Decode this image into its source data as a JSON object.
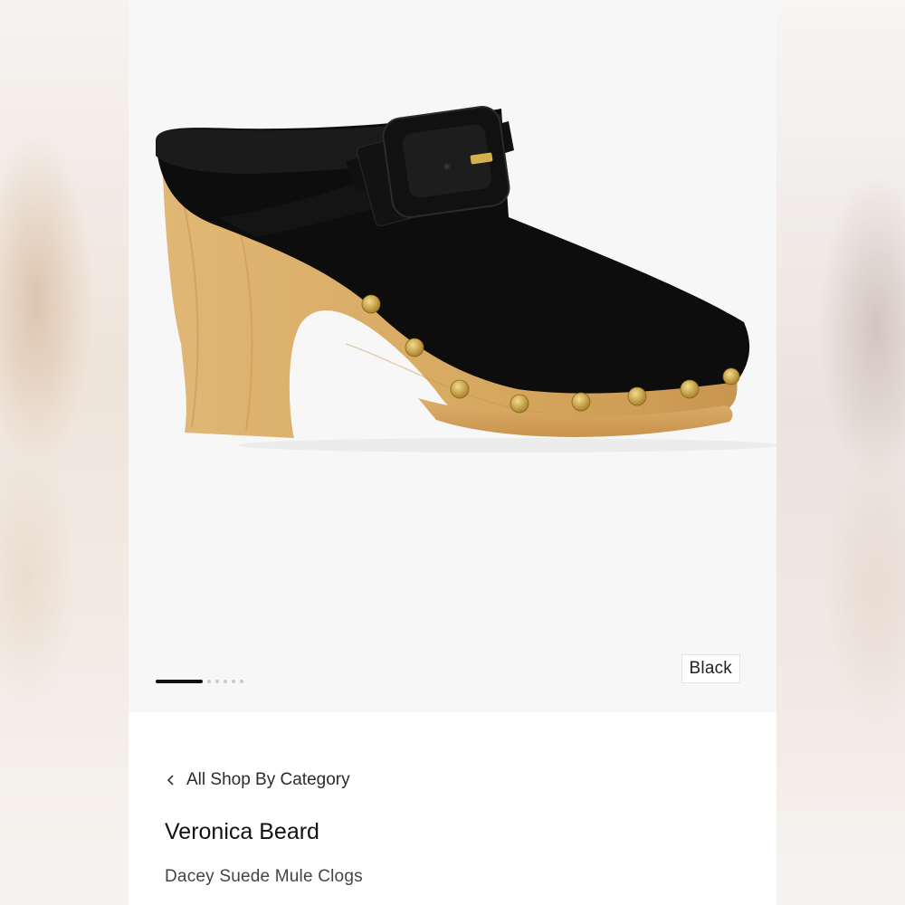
{
  "product": {
    "brand": "Veronica Beard",
    "name": "Dacey Suede Mule Clogs",
    "image_alt": "Black suede mule clog with wooden heel and gold studs",
    "selected_color": "Black"
  },
  "navigation": {
    "breadcrumb_label": "All Shop By Category",
    "back_icon": "chevron-left-icon"
  },
  "gallery": {
    "image_count": 6,
    "current_index": 1
  },
  "colors": {
    "accent": "#111111",
    "suede": "#0c0c0c",
    "wood": "#d6a863",
    "stud_gold": "#c9a03a"
  }
}
